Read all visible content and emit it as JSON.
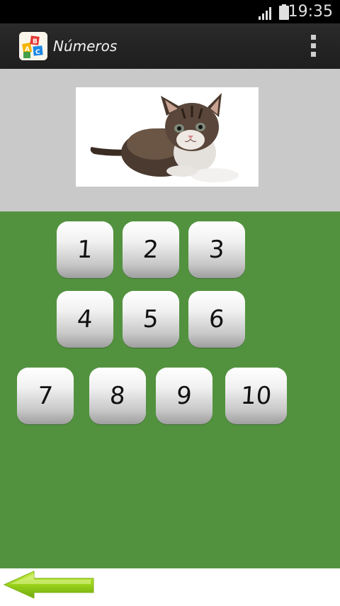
{
  "status_bar": {
    "time": "19:35",
    "icons": [
      "signal-icon",
      "battery-icon"
    ]
  },
  "action_bar": {
    "title": "Números",
    "app_icon": "abc-blocks-app-icon",
    "menu_icon": "overflow-menu-icon"
  },
  "image": {
    "subject": "kitten-icon"
  },
  "keypad": {
    "buttons": [
      "1",
      "2",
      "3",
      "4",
      "5",
      "6",
      "7",
      "8",
      "9",
      "10"
    ]
  },
  "navigation": {
    "back_icon": "back-arrow-icon"
  },
  "colors": {
    "keypad_background": "#52923f",
    "image_background": "#c9c9c9",
    "action_bar": "#232323",
    "status_bar": "#000000",
    "back_arrow": "#9ad21a"
  }
}
